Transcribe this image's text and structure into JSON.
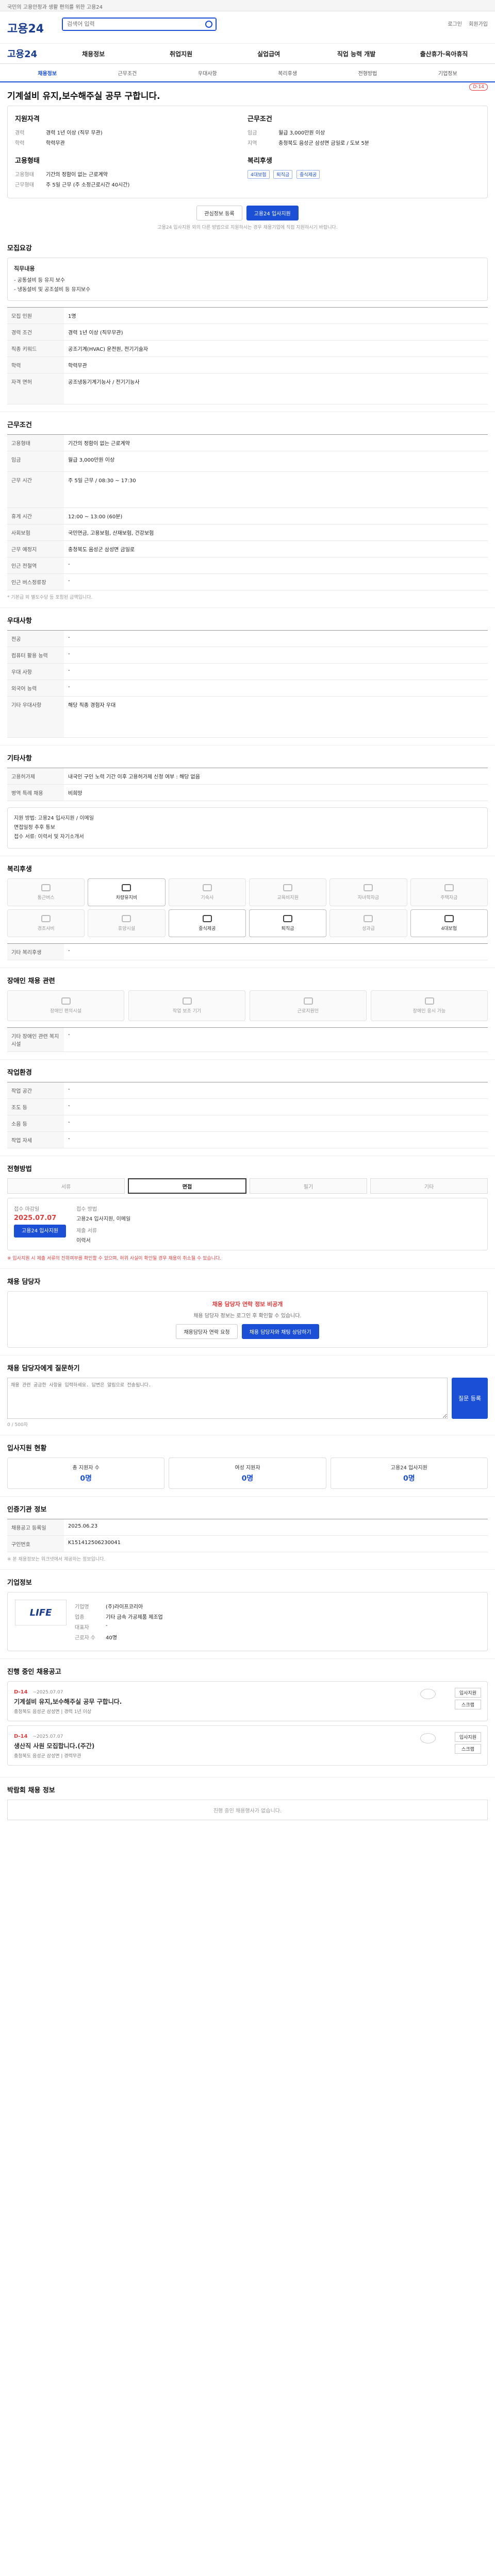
{
  "topbar": {
    "text": "국민의 고용안정과 생활 편의를 위한 고용24"
  },
  "header": {
    "logo": "고용24",
    "search_placeholder": "검색어 입력",
    "links": [
      "로그인",
      "회원가입"
    ]
  },
  "gnb": {
    "logo": "고용24",
    "items": [
      "채용정보",
      "취업지원",
      "실업급여",
      "직업 능력 개발",
      "출산휴가·육아휴직"
    ]
  },
  "tabs": [
    "채용정보",
    "근무조건",
    "우대사항",
    "복리후생",
    "전형방법",
    "기업정보"
  ],
  "job": {
    "title": "기계설비 유지,보수해주실 공무 구합니다.",
    "badge": "D-14"
  },
  "summary": {
    "left_title": "지원자격",
    "left": [
      {
        "k": "경력",
        "v": "경력 1년 이상 (직무 무관)"
      },
      {
        "k": "학력",
        "v": "학력무관"
      }
    ],
    "left_title2": "고용형태",
    "left2": [
      {
        "k": "고용형태",
        "v": "기간의 정함이 없는 근로계약"
      },
      {
        "k": "근무형태",
        "v": "주 5일 근무 (주 소정근로시간 40시간)"
      }
    ],
    "right_title": "근무조건",
    "right": [
      {
        "k": "임금",
        "v": "월급 3,000만원 이상"
      },
      {
        "k": "지역",
        "v": "충청북도 음성군 삼성면 금일로 / 도보 5분"
      }
    ],
    "right_title2": "복리후생",
    "right_tags": [
      "4대보험",
      "퇴직금",
      "중식제공"
    ],
    "btn_scrap": "관심정보 등록",
    "btn_apply": "고용24 입사지원",
    "note": "고용24 입사지원 외의 다른 방법으로 지원하시는 경우 채용기업에 직접 지원하시기 바랍니다."
  },
  "recruit": {
    "title": "모집요강",
    "duty_title": "직무내용",
    "duty": [
      "- 공통설비 등 유지 보수",
      "- 냉동설비 및 공조설비 등 유지보수"
    ],
    "rows": [
      {
        "th": "모집 인원",
        "td": "1명"
      },
      {
        "th": "경력 조건",
        "td": "경력 1년 이상 (직무무관)"
      },
      {
        "th": "직종 키워드",
        "td": "공조기계(HVAC) 운전원, 전기기술자"
      },
      {
        "th": "학력",
        "td": "학력무관"
      },
      {
        "th": "자격 면허",
        "td": "공조냉동기계기능사 / 전기기능사"
      }
    ]
  },
  "work": {
    "title": "근무조건",
    "rows": [
      {
        "th": "고용형태",
        "td": "기간의 정함이 없는 근로계약"
      },
      {
        "th": "임금",
        "td": "월급 3,000만원 이상"
      },
      {
        "th": "근무 시간",
        "td": "주 5일 근무 / 08:30 ~ 17:30"
      },
      {
        "th": "휴게 시간",
        "td": "12:00 ~ 13:00 (60분)"
      },
      {
        "th": "사회보험",
        "td": "국민연금, 고용보험, 산재보험, 건강보험"
      },
      {
        "th": "근무 예정지",
        "td": "충청북도 음성군 삼성면 금일로"
      },
      {
        "th": "인근 전철역",
        "td": "-"
      },
      {
        "th": "인근 버스정류장",
        "td": "-"
      }
    ],
    "note": "* 기본급 외 별도수당 등 포함된 금액입니다."
  },
  "prefer": {
    "title": "우대사항",
    "rows": [
      {
        "th": "전공",
        "td": "-"
      },
      {
        "th": "컴퓨터 활용 능력",
        "td": "-"
      },
      {
        "th": "우대 사항",
        "td": "-"
      },
      {
        "th": "외국어 능력",
        "td": "-"
      },
      {
        "th": "기타 우대사항",
        "td": "해당 직종 경험자 우대"
      }
    ]
  },
  "etc": {
    "title": "기타사항",
    "rows": [
      {
        "th": "고용허가제",
        "td": "내국인 구인 노력 기간 이후 고용허가제 신청 여부 : 해당 없음"
      },
      {
        "th": "병역 특례 채용",
        "td": "비희망"
      }
    ],
    "text": [
      "지원 방법: 고용24 입사지원 / 이메일",
      "면접일정 추후 통보",
      "접수 서류: 이력서 및 자기소개서"
    ]
  },
  "welfare": {
    "title": "복리후생",
    "items": [
      {
        "label": "통근버스",
        "on": false
      },
      {
        "label": "차량유지비",
        "on": true
      },
      {
        "label": "기숙사",
        "on": false
      },
      {
        "label": "교육비지원",
        "on": false
      },
      {
        "label": "자녀학자금",
        "on": false
      },
      {
        "label": "주택자금",
        "on": false
      },
      {
        "label": "경조사비",
        "on": false
      },
      {
        "label": "휴양시설",
        "on": false
      },
      {
        "label": "중식제공",
        "on": true
      },
      {
        "label": "퇴직금",
        "on": true
      },
      {
        "label": "성과급",
        "on": false
      },
      {
        "label": "4대보험",
        "on": true
      }
    ],
    "etc_label": "기타 복리후생",
    "etc_value": "-"
  },
  "disab": {
    "title": "장애인 채용 관련",
    "items": [
      "장애인 편의시설",
      "작업 보조 기기",
      "근로지원인",
      "장애인 응시 가능"
    ],
    "note_label": "기타 장애인 관련 복지시설",
    "note_value": "-"
  },
  "env": {
    "title": "작업환경",
    "rows": [
      {
        "th": "작업 공간",
        "td": "-"
      },
      {
        "th": "조도 등",
        "td": "-"
      },
      {
        "th": "소음 등",
        "td": "-"
      },
      {
        "th": "작업 자세",
        "td": "-"
      }
    ]
  },
  "process": {
    "title": "전형방법",
    "steps": [
      {
        "label": "서류",
        "on": false
      },
      {
        "label": "면접",
        "on": true
      },
      {
        "label": "필기",
        "on": false
      },
      {
        "label": "기타",
        "on": false
      }
    ],
    "deadline_label": "접수 마감일",
    "deadline": "2025.07.07",
    "method_label": "접수 방법",
    "method": "고용24 입사지원, 이메일",
    "docs_label": "제출 서류",
    "docs": "이력서",
    "apply_btn": "고용24 입사지원",
    "note": "※ 입사지원 시 제출 서류의 진위여부를 확인할 수 있으며, 허위 사실이 확인될 경우 채용이 취소될 수 있습니다."
  },
  "contact": {
    "title": "채용 담당자",
    "alert": "채용 담당자 연락 정보 비공개",
    "desc": "채용 담당자 정보는 로그인 후 확인할 수 있습니다.",
    "btn1": "채용담당자 연락 요청",
    "btn2": "채용 담당자와 채팅 상담하기"
  },
  "qa": {
    "title": "채용 담당자에게 질문하기",
    "placeholder": "채용 관련 궁금한 사항을 입력하세요. 답변은 알림으로 전송됩니다.",
    "btn": "질문 등록",
    "count": "0 / 500자"
  },
  "stats": {
    "title": "입사지원 현황",
    "items": [
      {
        "label": "총 지원자 수",
        "value": "0명"
      },
      {
        "label": "여성 지원자",
        "value": "0명"
      },
      {
        "label": "고용24 입사지원",
        "value": "0명"
      }
    ]
  },
  "info": {
    "title": "인증기관 정보",
    "rows": [
      {
        "th": "채용공고 등록일",
        "td": "2025.06.23"
      },
      {
        "th": "구인번호",
        "td": "K151412506230041"
      }
    ],
    "note": "※ 본 채용정보는 워크넷에서 제공하는 정보입니다."
  },
  "company": {
    "title": "기업정보",
    "logo": "LIFE",
    "rows": [
      {
        "k": "기업명",
        "v": "(주)라이프코리아"
      },
      {
        "k": "업종",
        "v": "기타 금속 가공제품 제조업"
      },
      {
        "k": "대표자",
        "v": "-"
      },
      {
        "k": "근로자 수",
        "v": "40명"
      }
    ]
  },
  "similar": {
    "title": "진행 중인 채용공고",
    "cards": [
      {
        "d": "D-14",
        "date": "~2025.07.07",
        "title": "기계설비 유지,보수해주실 공무 구합니다.",
        "meta": "충청북도 음성군 삼성면 | 경력 1년 이상",
        "btn1": "입사지원",
        "btn2": "스크랩"
      },
      {
        "d": "D-14",
        "date": "~2025.07.07",
        "title": "생산직 사원 모집합니다.(주간)",
        "meta": "충청북도 음성군 삼성면 | 경력무관",
        "btn1": "입사지원",
        "btn2": "스크랩"
      }
    ]
  },
  "footer": {
    "title": "박람회 채용 정보",
    "empty": "진행 중인 채용행사가 없습니다."
  }
}
